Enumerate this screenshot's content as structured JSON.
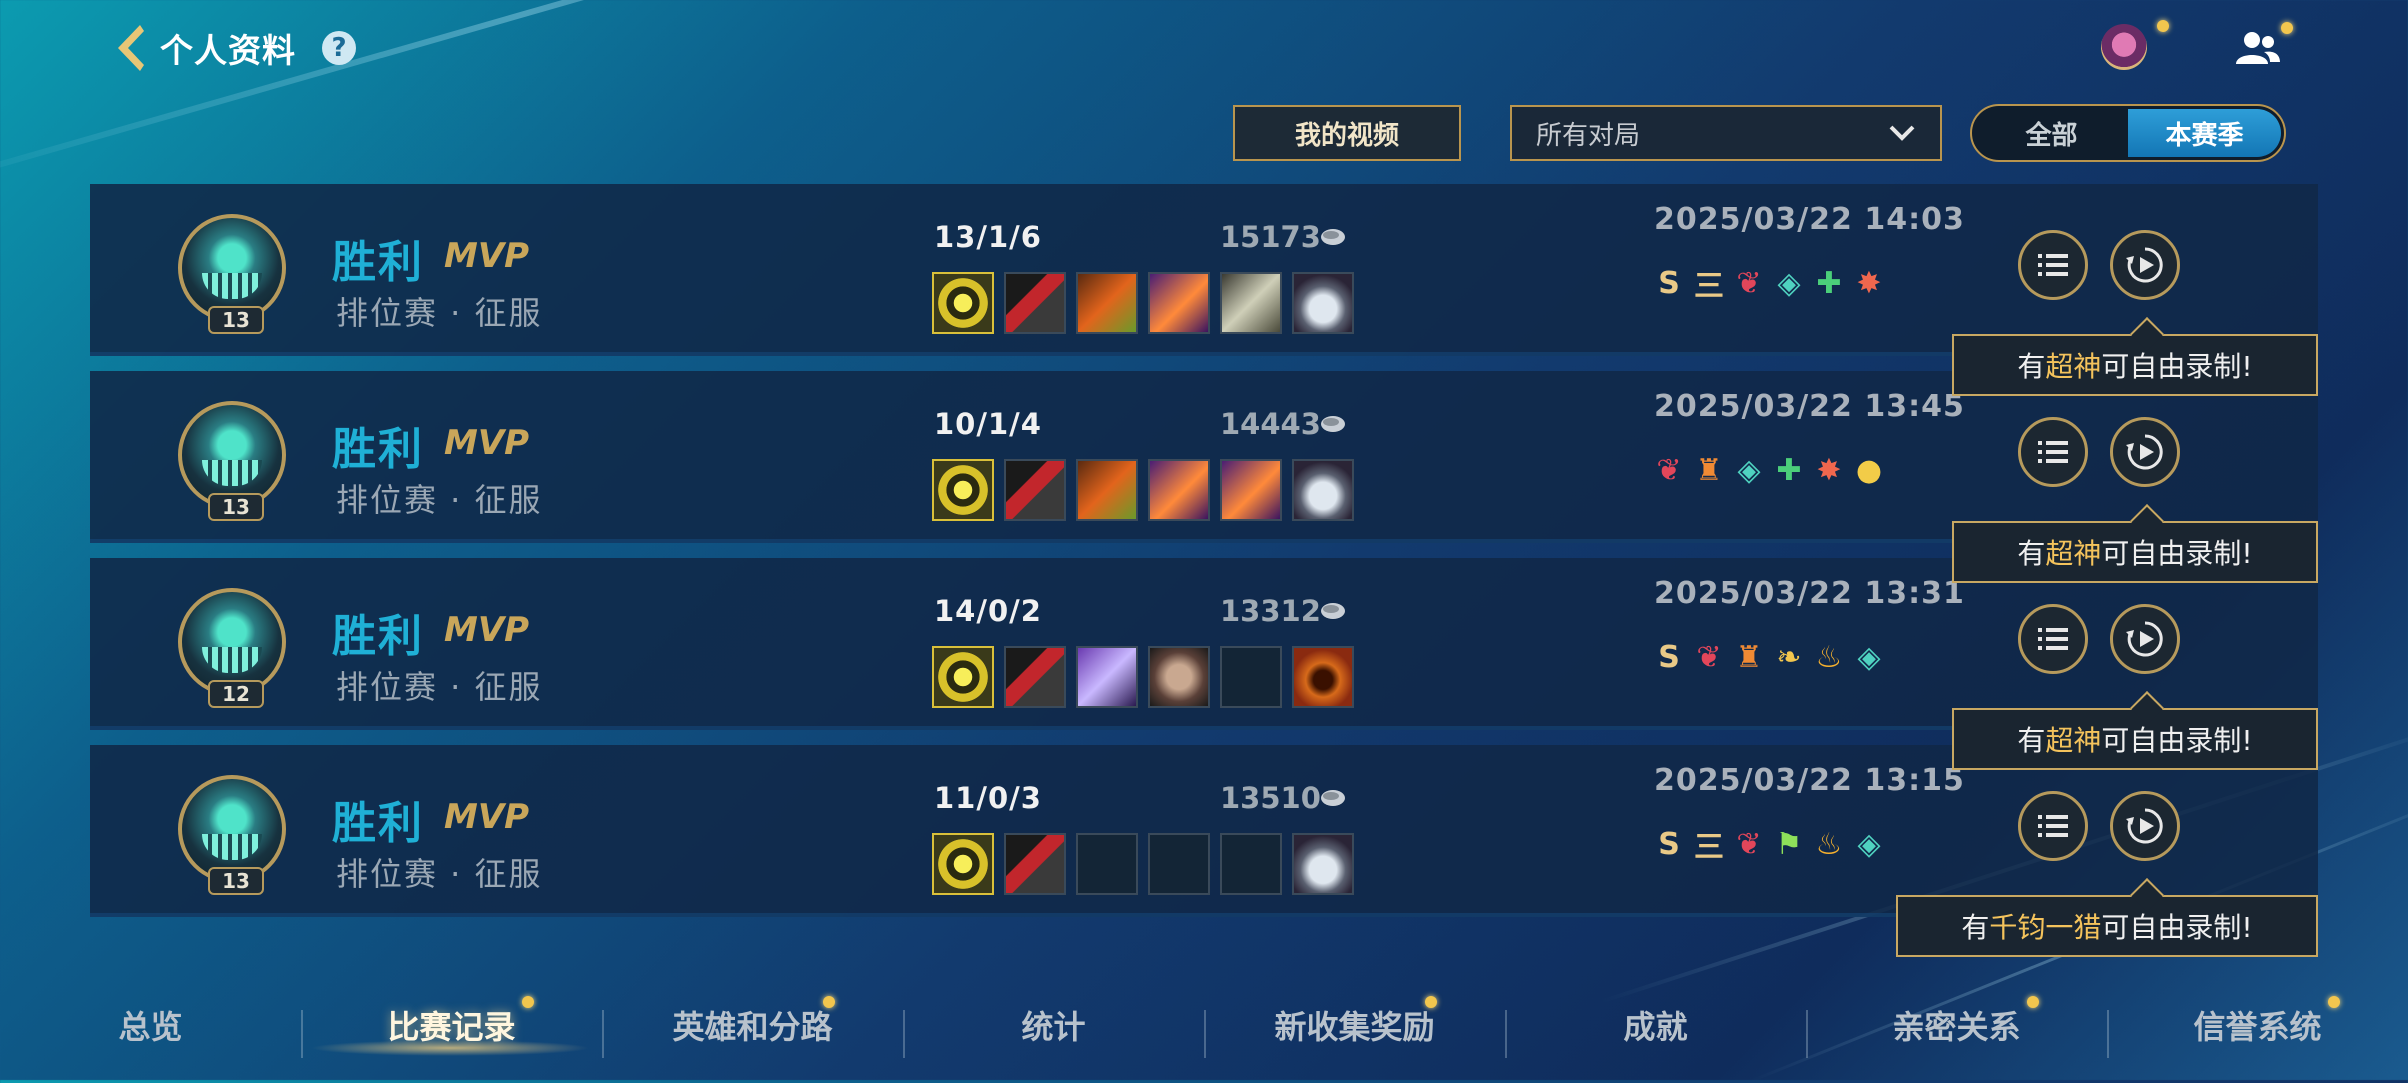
{
  "header": {
    "title": "个人资料",
    "help_label": "?"
  },
  "controls": {
    "my_videos_label": "我的视频",
    "match_filter_value": "所有对局",
    "toggle_all": "全部",
    "toggle_season": "本赛季",
    "selected_toggle": "本赛季"
  },
  "matches": [
    {
      "result": "胜利",
      "mvp": "MVP",
      "mode": "排位赛 · 征服",
      "level": "13",
      "kda": "13/1/6",
      "gold": "15173",
      "date": "2025/03/22 14:03",
      "badges": [
        "S",
        "三",
        "wing",
        "shield",
        "heal",
        "flame"
      ],
      "callout_prefix": "有",
      "callout_highlight": "超神",
      "callout_suffix": "可自由录制!"
    },
    {
      "result": "胜利",
      "mvp": "MVP",
      "mode": "排位赛 · 征服",
      "level": "13",
      "kda": "10/1/4",
      "gold": "14443",
      "date": "2025/03/22 13:45",
      "badges": [
        "wing",
        "tower",
        "shield",
        "heal",
        "flame",
        "coin"
      ],
      "callout_prefix": "有",
      "callout_highlight": "超神",
      "callout_suffix": "可自由录制!"
    },
    {
      "result": "胜利",
      "mvp": "MVP",
      "mode": "排位赛 · 征服",
      "level": "12",
      "kda": "14/0/2",
      "gold": "13312",
      "date": "2025/03/22 13:31",
      "badges": [
        "S",
        "wing",
        "tower",
        "dragon",
        "fire",
        "shield"
      ],
      "callout_prefix": "有",
      "callout_highlight": "超神",
      "callout_suffix": "可自由录制!"
    },
    {
      "result": "胜利",
      "mvp": "MVP",
      "mode": "排位赛 · 征服",
      "level": "13",
      "kda": "11/0/3",
      "gold": "13510",
      "date": "2025/03/22 13:15",
      "badges": [
        "S",
        "三",
        "wing",
        "flag",
        "fire",
        "shield"
      ],
      "callout_prefix": "有",
      "callout_highlight": "千钧一猎",
      "callout_suffix": "可自由录制!"
    }
  ],
  "tabs": [
    "总览",
    "比赛记录",
    "英雄和分路",
    "统计",
    "新收集奖励",
    "成就",
    "亲密关系",
    "信誉系统"
  ],
  "active_tab": "比赛记录",
  "colors": {
    "win": "#1fb0d6",
    "gold_accent": "#c9a65a",
    "highlight": "#f4c35c"
  }
}
